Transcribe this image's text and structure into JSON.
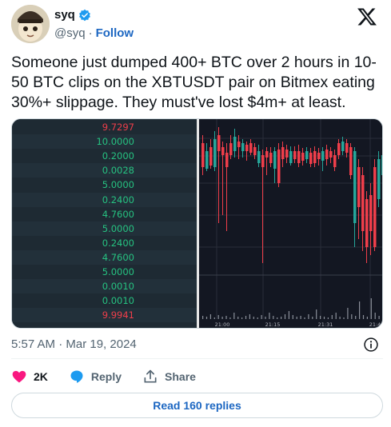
{
  "author": {
    "name": "syq",
    "handle": "@syq",
    "separator": "·",
    "follow_label": "Follow",
    "verified_color": "#1d9bf0"
  },
  "tweet": {
    "text": "Someone just dumped 400+ BTC over 2 hours in 10-50 BTC clips on the XBTUSDT pair on Bitmex eating 30%+ slippage. They must've lost $4m+ at least.",
    "timestamp": "5:57 AM · Mar 19, 2024"
  },
  "media": {
    "orderbook_rows": [
      {
        "value": "9.7297",
        "side": "red"
      },
      {
        "value": "10.0000",
        "side": "green"
      },
      {
        "value": "0.2000",
        "side": "green"
      },
      {
        "value": "0.0028",
        "side": "green"
      },
      {
        "value": "5.0000",
        "side": "green"
      },
      {
        "value": "0.2400",
        "side": "green"
      },
      {
        "value": "4.7600",
        "side": "green"
      },
      {
        "value": "5.0000",
        "side": "green"
      },
      {
        "value": "0.2400",
        "side": "green"
      },
      {
        "value": "4.7600",
        "side": "green"
      },
      {
        "value": "5.0000",
        "side": "green"
      },
      {
        "value": "0.0010",
        "side": "green"
      },
      {
        "value": "0.0010",
        "side": "green"
      },
      {
        "value": "9.9941",
        "side": "red"
      }
    ],
    "time_labels": [
      "21:00",
      "21:15",
      "21:31",
      "21:4"
    ],
    "colors": {
      "up": "#26a69a",
      "down": "#ef3e4a",
      "volume": "#8a8f99",
      "grid": "#2a2e39"
    }
  },
  "actions": {
    "likes": "2K",
    "reply_label": "Reply",
    "share_label": "Share",
    "read_replies_label": "Read 160 replies"
  }
}
